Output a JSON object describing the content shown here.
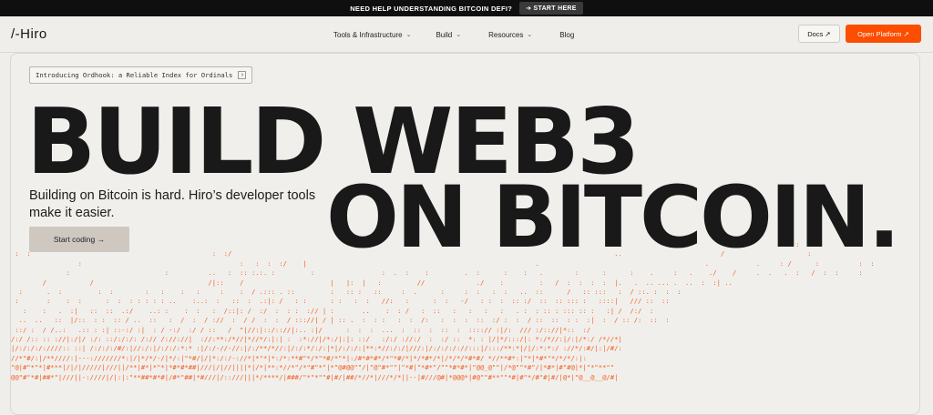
{
  "banner": {
    "text": "NEED HELP UNDERSTANDING BITCOIN DEFI?",
    "button": "➜ START HERE"
  },
  "nav": {
    "logo": "/-Hiro",
    "links": [
      {
        "label": "Tools & Infrastructure",
        "chevron": "⌄"
      },
      {
        "label": "Build",
        "chevron": "⌄"
      },
      {
        "label": "Resources",
        "chevron": "⌄"
      },
      {
        "label": "Blog",
        "chevron": ""
      }
    ],
    "docs": "Docs ↗",
    "open_platform": "Open Platform ↗"
  },
  "hero": {
    "pill": "Introducing Ordhook: a Reliable Index for Ordinals",
    "pill_arrow": "›",
    "headline_1": "BUILD WEB3",
    "headline_2": "ON BITCOIN.",
    "subtitle": "Building on Bitcoin is hard. Hiro’s developer tools make it easier.",
    "cta": "Start coding →"
  },
  "ascii_art": [
    "                                                                                                                                                                                                       :                                                                                       ",
    " :  :                                              :  :/                                                                                                 ..                         /                     :                    ",
    "                 :                                        :   :  :  :/    |                                                          .                                          .            .     : /      :          :  :",
    "              :                        :          ..   :  :: :.:. :         :                 :  .  :    :         .  :      :    :   .        :      :      :    .     :   .    ./    /     .  .   .  :   /  :  :     : ",
    "        /           /                             /|::    /                      |   |:  |   :         //             ./    :         :   /  :  :  :  :  |.   .  .. ... .  ..  :  :| ..",
    "  :      .  :         :  :        :   :    :   :     :    :  / .::: . ::         :   :: :   ::     :  .      :     :  :   :  :   ..  ::      /   :: :::   :  / ::. :  :  :",
    " :       :    :  :      :  :  : : : : : ..    :..:  :   ::  :  .:|: /   : :      : :   :  :   //:   :      :  :   -/   : :  :  :: :/  ::  :: ::: :   ::::|   /// ::  ::",
    "   :    :   .  :|   ::  ::  .:/    ..: :    :  :   :  /::|: /  :/  :  : :  :// | :       ..    :  : /   :  ::   :   :   :   :   . :  : :: : ::: :: :   :| /  /:/  :",
    "  ..  ..   ::  |/::  : :  :: / ..  ::   :  /  :  / ://  :  / /  :  :  / ::://| / | :: .  :  : :   :  :  /:   :  :  :  ::  :/ :  :  / ::  ::  : :  :|  :  / :: /:  ::  :",
    " ::/ :  / /..:   .:: : :| ::-:/ :|  : / -:/  :/ / ::   /  \"|//:|::/:://|:.. :|/      :  :  :  ...  :  ::  :  ::  :  ::::// :|/:  /// :/:://|*::  :/",
    "/:/ /:: :: ://|:/|/ :/: ::/:/:/: /:// /://://|  ://:**:/*//|*//*/:|:| :  :*://|/*:/|:|: ::/   :/:/ ://:/  :  :/ ::  *: : |/|*/:::/|: *:/*//:|/:|/*:/ /*//*|  ",
    "|/:/:/:/:////:: ::| /:/:/:/#/:|//:/:|/:/:/:*:* :|/:/-//-//:|/:/**/*//:|/:/:*/:/:|*|/:/:/:|**:*//:/:/|///:|/:/:/:/://:::|/:::/**:*|/|/:*:*:/ ://*/:#/|:|/#/:",
    "//*\"#/:|/**////:|---:///////*:|/|*/*/-/|*/:|\"*#/|/|*:/:/-://*|*\"*|*:/*:**#\"*/*\"*#/*\"*|:/#*#*#*/*\"*#/*|*/*#*/*|/*/*/*#*#/ *//**#*:|\"*|*#*\"*/*/*/:|:",
    "\"@|#\"*\"*|#***|/|/|/////|///||/**|#*|*\"*|*#*#*##|///|/|//||||*|/*|**:*//*\"/*\"#\"*\"|*\"@#@@\"\"/|\"@\"#*\"\"|\"*#|\"*#*\"/\"\"*#*#*|\"@@_@\"\"|/*@\"\"*#\"/|*#*|#\"#@|*|\"*\"**\"\"",
    "@@\"#\"*#|##*\"|///||-:////|/|:|:\"**##*#*#|/#*\"##|*#///|/::///|||*/****/|###/\"*\"*\"\"#|#/|##/*//*|///*/*||--|#///@#|*@@@*|#@\"\"#**\"\"*#|#\"*/#\"#|#/|@*|\"@__@__@/#|  "
  ],
  "colors": {
    "accent": "#fc4d00",
    "ascii": "#f25d22",
    "background": "#f0eeea",
    "text": "#141414"
  },
  "icons": [
    "arrow-right-icon",
    "external-link-icon",
    "chevron-down-icon"
  ]
}
